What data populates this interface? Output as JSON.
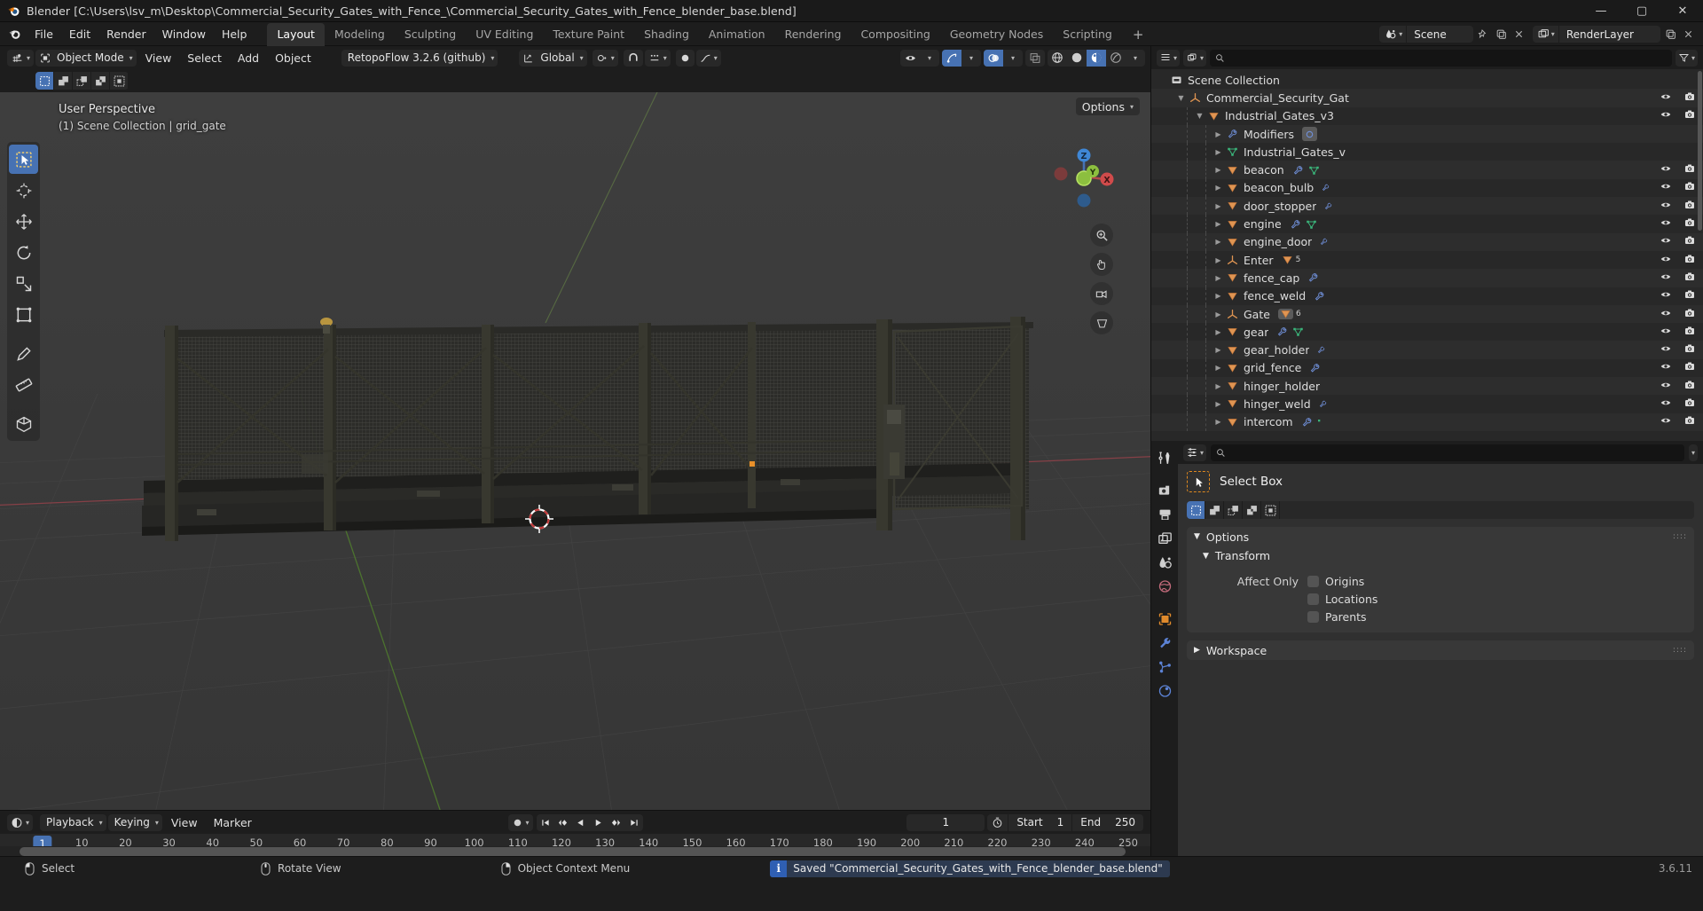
{
  "titlebar": {
    "title": "Blender [C:\\Users\\lsv_m\\Desktop\\Commercial_Security_Gates_with_Fence_\\Commercial_Security_Gates_with_Fence_blender_base.blend]",
    "minimize": "—",
    "maximize": "▢",
    "close": "✕"
  },
  "topbar": {
    "menus": [
      "File",
      "Edit",
      "Render",
      "Window",
      "Help"
    ],
    "workspaces": [
      {
        "label": "Layout",
        "active": true
      },
      {
        "label": "Modeling",
        "active": false
      },
      {
        "label": "Sculpting",
        "active": false
      },
      {
        "label": "UV Editing",
        "active": false
      },
      {
        "label": "Texture Paint",
        "active": false
      },
      {
        "label": "Shading",
        "active": false
      },
      {
        "label": "Animation",
        "active": false
      },
      {
        "label": "Rendering",
        "active": false
      },
      {
        "label": "Compositing",
        "active": false
      },
      {
        "label": "Geometry Nodes",
        "active": false
      },
      {
        "label": "Scripting",
        "active": false
      }
    ],
    "add_workspace": "+",
    "scene_name": "Scene",
    "viewlayer_name": "RenderLayer"
  },
  "viewport_header": {
    "mode": "Object Mode",
    "menus": [
      "View",
      "Select",
      "Add",
      "Object"
    ],
    "addon": "RetopoFlow 3.2.6 (github)",
    "orientation": "Global"
  },
  "viewport": {
    "perspective": "User Perspective",
    "scene_info": "(1) Scene Collection | grid_gate",
    "options_label": "Options",
    "gizmo_axes": [
      "X",
      "Y",
      "Z"
    ]
  },
  "toolbar": {
    "tools": [
      {
        "name": "tweak-tool",
        "active": true
      },
      {
        "name": "cursor-tool",
        "active": false
      },
      {
        "name": "move-tool",
        "active": false
      },
      {
        "name": "rotate-tool",
        "active": false
      },
      {
        "name": "scale-tool",
        "active": false
      },
      {
        "name": "transform-tool",
        "active": false
      },
      {
        "name": "annotate-tool",
        "active": false
      },
      {
        "name": "measure-tool",
        "active": false
      },
      {
        "name": "add-cube-tool",
        "active": false
      }
    ]
  },
  "outliner": {
    "search_placeholder": "",
    "rows": [
      {
        "label": "Scene Collection",
        "indent": 0,
        "icon": "collection-icon",
        "arrow": "",
        "vis": false,
        "badges": []
      },
      {
        "label": "Commercial_Security_Gat",
        "indent": 1,
        "icon": "empty-axes-icon",
        "arrow": "down",
        "vis": true,
        "badges": []
      },
      {
        "label": "Industrial_Gates_v3",
        "indent": 2,
        "icon": "mesh-data-icon",
        "arrow": "down",
        "vis": true,
        "badges": []
      },
      {
        "label": "Modifiers",
        "indent": 3,
        "icon": "wrench-icon",
        "arrow": "right",
        "vis": false,
        "badges": [
          "modifier-chip"
        ]
      },
      {
        "label": "Industrial_Gates_v",
        "indent": 3,
        "icon": "mesh-tri-icon",
        "arrow": "right",
        "vis": false,
        "badges": []
      },
      {
        "label": "beacon",
        "indent": 3,
        "icon": "mesh-data-icon",
        "arrow": "right",
        "vis": true,
        "badges": [
          "wrench",
          "mesh"
        ]
      },
      {
        "label": "beacon_bulb",
        "indent": 3,
        "icon": "mesh-data-icon",
        "arrow": "right",
        "vis": true,
        "badges": [
          "wrench-sm"
        ]
      },
      {
        "label": "door_stopper",
        "indent": 3,
        "icon": "mesh-data-icon",
        "arrow": "right",
        "vis": true,
        "badges": [
          "wrench-sm"
        ]
      },
      {
        "label": "engine",
        "indent": 3,
        "icon": "mesh-data-icon",
        "arrow": "right",
        "vis": true,
        "badges": [
          "wrench",
          "mesh"
        ]
      },
      {
        "label": "engine_door",
        "indent": 3,
        "icon": "mesh-data-icon",
        "arrow": "right",
        "vis": true,
        "badges": [
          "wrench-sm"
        ]
      },
      {
        "label": "Enter",
        "indent": 3,
        "icon": "empty-axes-icon",
        "arrow": "right",
        "vis": true,
        "badges": [
          "mesh-count"
        ],
        "count": "5"
      },
      {
        "label": "fence_cap",
        "indent": 3,
        "icon": "mesh-data-icon",
        "arrow": "right",
        "vis": true,
        "badges": [
          "wrench"
        ]
      },
      {
        "label": "fence_weld",
        "indent": 3,
        "icon": "mesh-data-icon",
        "arrow": "right",
        "vis": true,
        "badges": [
          "wrench"
        ]
      },
      {
        "label": "Gate",
        "indent": 3,
        "icon": "empty-axes-icon",
        "arrow": "right",
        "vis": true,
        "badges": [
          "mesh-count-sel"
        ],
        "count": "6"
      },
      {
        "label": "gear",
        "indent": 3,
        "icon": "mesh-data-icon",
        "arrow": "right",
        "vis": true,
        "badges": [
          "wrench",
          "mesh"
        ]
      },
      {
        "label": "gear_holder",
        "indent": 3,
        "icon": "mesh-data-icon",
        "arrow": "right",
        "vis": true,
        "badges": [
          "wrench-sm"
        ]
      },
      {
        "label": "grid_fence",
        "indent": 3,
        "icon": "mesh-data-icon",
        "arrow": "right",
        "vis": true,
        "badges": [
          "wrench"
        ]
      },
      {
        "label": "hinger_holder",
        "indent": 3,
        "icon": "mesh-data-icon",
        "arrow": "right",
        "vis": true,
        "badges": []
      },
      {
        "label": "hinger_weld",
        "indent": 3,
        "icon": "mesh-data-icon",
        "arrow": "right",
        "vis": true,
        "badges": [
          "wrench-sm"
        ]
      },
      {
        "label": "intercom",
        "indent": 3,
        "icon": "mesh-data-icon",
        "arrow": "right",
        "vis": true,
        "badges": [
          "wrench",
          "mesh-sm"
        ]
      }
    ]
  },
  "properties": {
    "search_placeholder": "",
    "tool_title": "Select Box",
    "select_modes": [
      "set",
      "extend",
      "subtract",
      "invert",
      "intersect"
    ],
    "panels": [
      {
        "title": "Options",
        "expanded": true,
        "sub": {
          "title": "Transform",
          "expanded": true,
          "row_label": "Affect Only",
          "checkboxes": [
            {
              "label": "Origins",
              "checked": false
            },
            {
              "label": "Locations",
              "checked": false
            },
            {
              "label": "Parents",
              "checked": false
            }
          ]
        }
      },
      {
        "title": "Workspace",
        "expanded": false
      }
    ]
  },
  "timeline": {
    "menus": [
      "Playback",
      "Keying",
      "View",
      "Marker"
    ],
    "current_frame": "1",
    "start_label": "Start",
    "start_value": "1",
    "end_label": "End",
    "end_value": "250",
    "ticks": [
      1,
      10,
      20,
      30,
      40,
      50,
      60,
      70,
      80,
      90,
      100,
      110,
      120,
      130,
      140,
      150,
      160,
      170,
      180,
      190,
      200,
      210,
      220,
      230,
      240,
      250
    ]
  },
  "statusbar": {
    "hints": [
      {
        "label": "Select",
        "mouse": "left"
      },
      {
        "label": "Rotate View",
        "mouse": "middle"
      },
      {
        "label": "Object Context Menu",
        "mouse": "right"
      }
    ],
    "report": "Saved \"Commercial_Security_Gates_with_Fence_blender_base.blend\"",
    "version": "3.6.11"
  },
  "colors": {
    "accent_blue": "#4772b3",
    "orange": "#e0891f",
    "mesh_green": "#3ab57a",
    "modifier_blue": "#6f8fd8",
    "bg_dark": "#1d1d1d",
    "bg_panel": "#303030",
    "viewport": "#3b3b3b"
  }
}
